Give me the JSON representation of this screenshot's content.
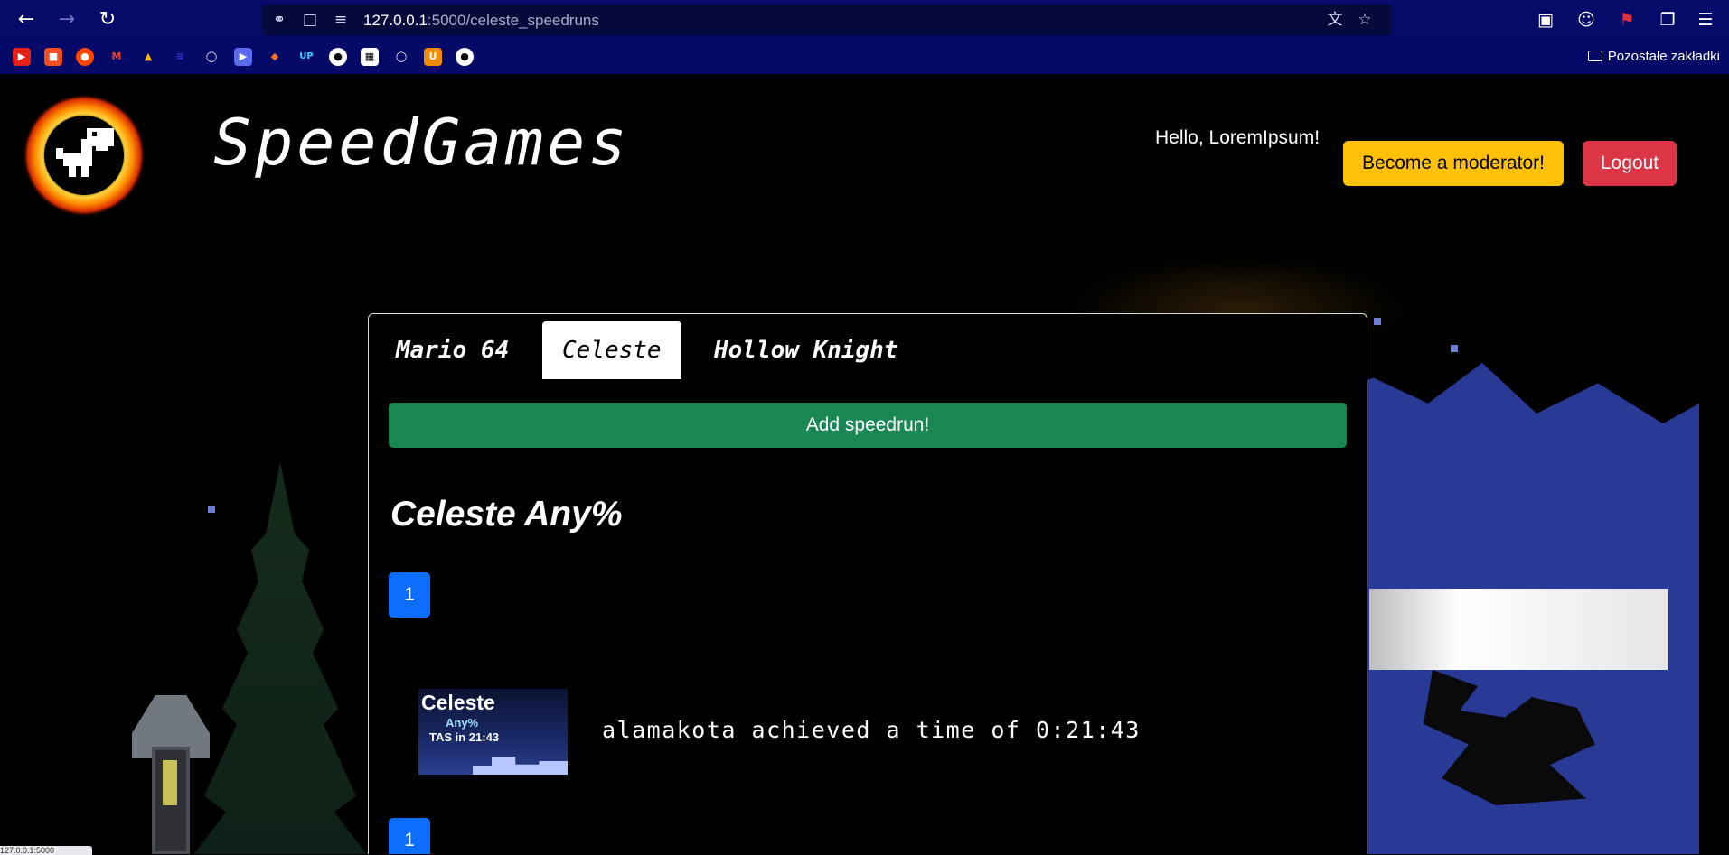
{
  "browser": {
    "url_host": "127.0.0.1",
    "url_path": ":5000/celeste_speedruns",
    "nav_icons": [
      "back-icon",
      "forward-icon",
      "reload-icon"
    ],
    "bookmark_folder_label": "Pozostałe zakładki",
    "status_url": "127.0.0.1:5000"
  },
  "header": {
    "site_title": "SpeedGames",
    "greeting": "Hello, LoremIpsum!",
    "moderator_button": "Become a moderator!",
    "logout_button": "Logout",
    "colors": {
      "moderator": "#ffc107",
      "logout": "#dc3545"
    }
  },
  "tabs": [
    {
      "label": "Mario 64",
      "active": false
    },
    {
      "label": "Celeste",
      "active": true
    },
    {
      "label": "Hollow Knight",
      "active": false
    }
  ],
  "add_button": "Add speedrun!",
  "category": {
    "title": "Celeste Any%",
    "pages": [
      {
        "label": "1"
      },
      {
        "label": "1"
      }
    ]
  },
  "runs": [
    {
      "thumbnail": {
        "title": "Celeste",
        "subtitle": "Any%",
        "caption": "TAS in 21:43"
      },
      "text": "alamakota achieved a time of 0:21:43"
    }
  ],
  "colors": {
    "add": "#198754",
    "badge": "#0d6efd"
  }
}
